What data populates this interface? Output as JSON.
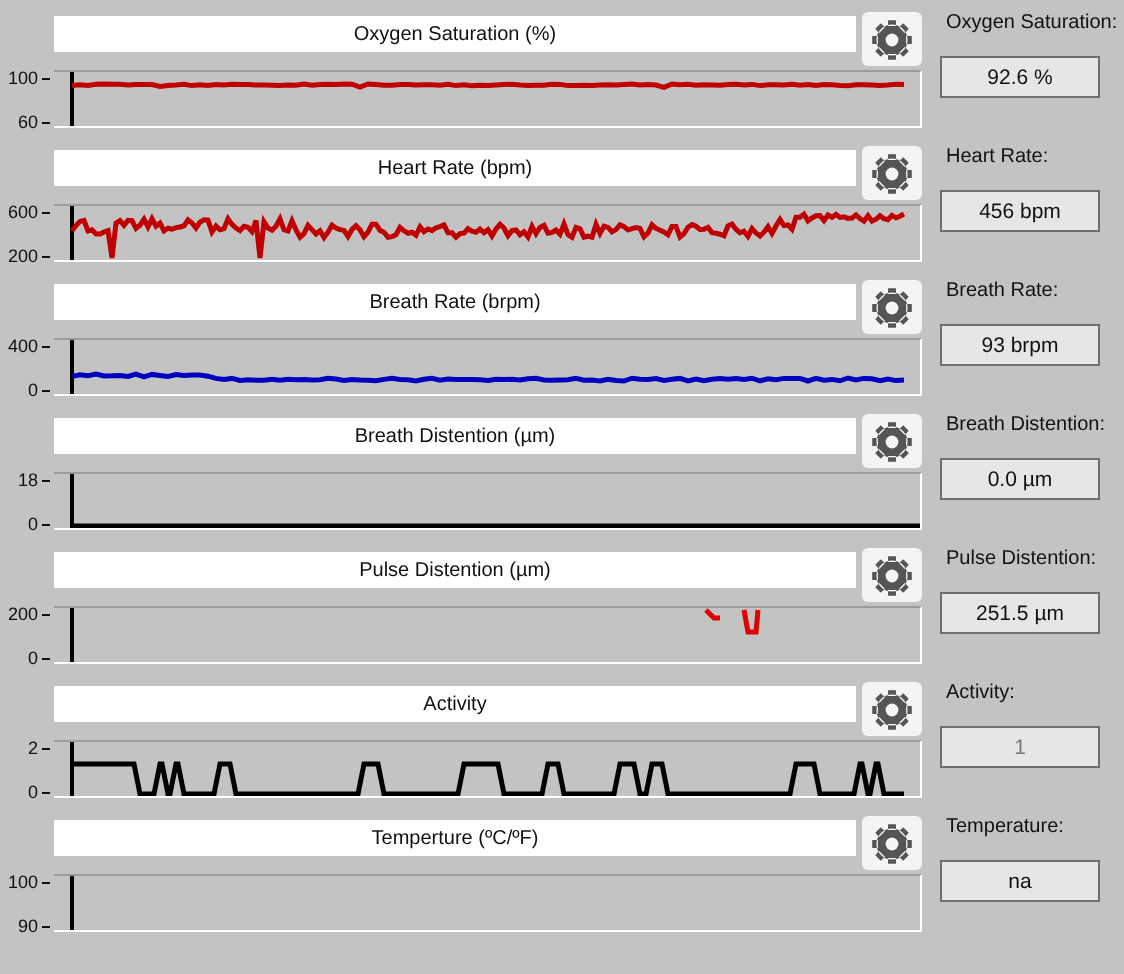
{
  "panels": [
    {
      "title": "Oxygen Saturation (%)",
      "yticks": [
        "100",
        "60"
      ],
      "trace": {
        "kind": "high"
      },
      "readout": {
        "label": "Oxygen Saturation:",
        "value": "92.6 %",
        "disabled": false
      }
    },
    {
      "title": "Heart Rate (bpm)",
      "yticks": [
        "600",
        "200"
      ],
      "trace": {
        "kind": "noisy"
      },
      "readout": {
        "label": "Heart Rate:",
        "value": "456 bpm",
        "disabled": false
      }
    },
    {
      "title": "Breath Rate (brpm)",
      "yticks": [
        "400",
        "0"
      ],
      "trace": {
        "kind": "low"
      },
      "readout": {
        "label": "Breath Rate:",
        "value": "93 brpm",
        "disabled": false
      }
    },
    {
      "title": "Breath Distention (µm)",
      "yticks": [
        "18",
        "0"
      ],
      "trace": {
        "kind": "zero"
      },
      "readout": {
        "label": "Breath Distention:",
        "value": "0.0 µm",
        "disabled": false
      }
    },
    {
      "title": "Pulse Distention (µm)",
      "yticks": [
        "200",
        "0"
      ],
      "trace": {
        "kind": "dips"
      },
      "readout": {
        "label": "Pulse Distention:",
        "value": "251.5 µm",
        "disabled": false
      }
    },
    {
      "title": "Activity",
      "yticks": [
        "2",
        "0"
      ],
      "trace": {
        "kind": "steps"
      },
      "readout": {
        "label": "Activity:",
        "value": "1",
        "disabled": true
      }
    },
    {
      "title": "Temperture (ºC/ºF)",
      "yticks": [
        "100",
        "90"
      ],
      "trace": {
        "kind": "empty"
      },
      "readout": {
        "label": "Temperature:",
        "value": "na",
        "disabled": false
      }
    }
  ]
}
